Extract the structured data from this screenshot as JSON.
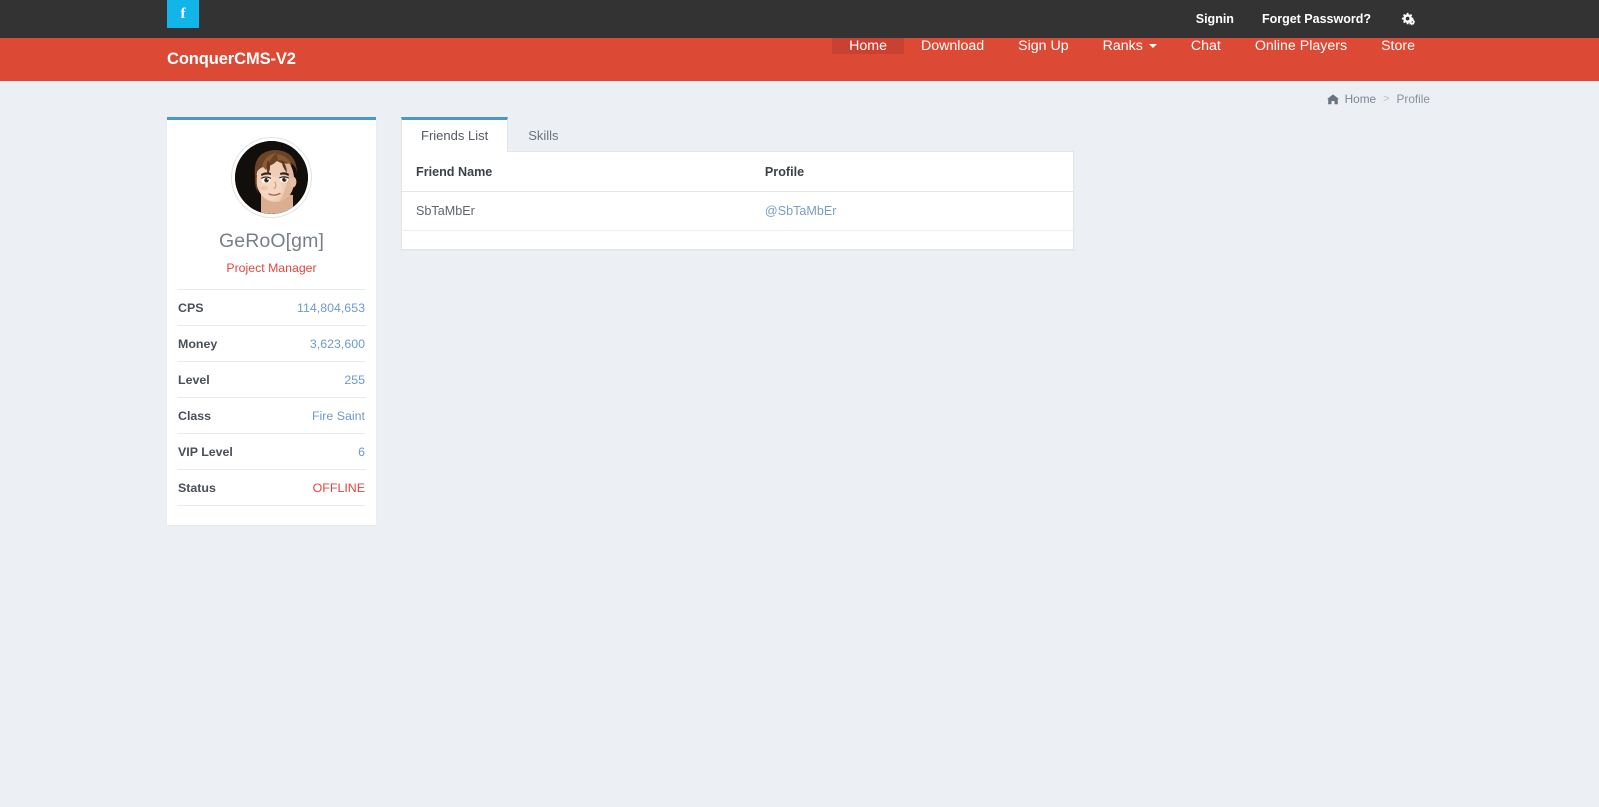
{
  "topbar": {
    "social": {
      "icon": "facebook-icon",
      "glyph": "f",
      "color": "#12b5e8"
    },
    "links": [
      {
        "label": "Signin",
        "name": "signin-link"
      },
      {
        "label": "Forget Password?",
        "name": "forget-password-link"
      }
    ],
    "settings_icon": "gears-icon"
  },
  "navbar": {
    "brand": "ConquerCMS-V2",
    "brand_color": "#dc4935",
    "active_color": "#c94231",
    "items": [
      {
        "label": "Home",
        "active": true
      },
      {
        "label": "Download",
        "active": false
      },
      {
        "label": "Sign Up",
        "active": false
      },
      {
        "label": "Ranks",
        "active": false,
        "dropdown": true
      },
      {
        "label": "Chat",
        "active": false
      },
      {
        "label": "Online Players",
        "active": false
      },
      {
        "label": "Store",
        "active": false
      }
    ]
  },
  "breadcrumb": {
    "home_icon": "home-icon",
    "home": "Home",
    "separator": ">",
    "current": "Profile"
  },
  "profile": {
    "avatar_icon": "player-avatar",
    "name": "GeRoO[gm]",
    "role": "Project Manager",
    "role_color": "#e4453c",
    "accent_color": "#4a97c8",
    "stats": [
      {
        "label": "CPS",
        "value": "114,804,653",
        "style": "link"
      },
      {
        "label": "Money",
        "value": "3,623,600",
        "style": "link"
      },
      {
        "label": "Level",
        "value": "255",
        "style": "link"
      },
      {
        "label": "Class",
        "value": "Fire Saint",
        "style": "link"
      },
      {
        "label": "VIP Level",
        "value": "6",
        "style": "link"
      },
      {
        "label": "Status",
        "value": "OFFLINE",
        "style": "danger"
      }
    ]
  },
  "tabs": [
    {
      "label": "Friends List",
      "active": true
    },
    {
      "label": "Skills",
      "active": false
    }
  ],
  "friends_table": {
    "columns": [
      "Friend Name",
      "Profile"
    ],
    "rows": [
      {
        "name": "SbTaMbEr",
        "profile": "@SbTaMbEr"
      }
    ]
  }
}
